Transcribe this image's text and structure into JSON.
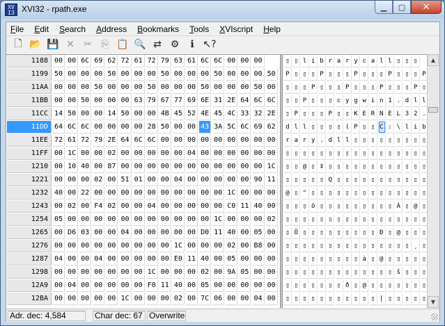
{
  "window": {
    "title": "XVI32 - rpath.exe"
  },
  "menu": [
    {
      "label": "File",
      "u": "F",
      "rest": "ile"
    },
    {
      "label": "Edit",
      "u": "E",
      "rest": "dit"
    },
    {
      "label": "Search",
      "u": "S",
      "rest": "earch"
    },
    {
      "label": "Address",
      "u": "A",
      "rest": "ddress"
    },
    {
      "label": "Bookmarks",
      "u": "B",
      "rest": "ookmarks"
    },
    {
      "label": "Tools",
      "u": "T",
      "rest": "ools"
    },
    {
      "label": "XVIscript",
      "u": "X",
      "rest": "VIscript"
    },
    {
      "label": "Help",
      "u": "H",
      "rest": "elp"
    }
  ],
  "toolbar": [
    {
      "name": "new-file-icon",
      "glyph": "🗋",
      "enabled": true
    },
    {
      "name": "open-folder-icon",
      "glyph": "📂",
      "enabled": true
    },
    {
      "name": "save-icon",
      "glyph": "💾",
      "enabled": true
    },
    {
      "name": "close-file-icon",
      "glyph": "✕",
      "enabled": false
    },
    {
      "name": "cut-icon",
      "glyph": "✂",
      "enabled": false
    },
    {
      "name": "copy-icon",
      "glyph": "⎘",
      "enabled": false
    },
    {
      "name": "paste-icon",
      "glyph": "📋",
      "enabled": true
    },
    {
      "name": "find-icon",
      "glyph": "🔍",
      "enabled": true
    },
    {
      "name": "replace-icon",
      "glyph": "⇄",
      "enabled": true
    },
    {
      "name": "properties-icon",
      "glyph": "⚙",
      "enabled": true
    },
    {
      "name": "script-icon",
      "glyph": "ℹ",
      "enabled": true
    },
    {
      "name": "context-help-icon",
      "glyph": "↖?",
      "enabled": true
    }
  ],
  "rows": [
    {
      "addr": "1188",
      "hex": [
        "00",
        "00",
        "6C",
        "69",
        "62",
        "72",
        "61",
        "72",
        "79",
        "63",
        "61",
        "6C",
        "6C",
        "00",
        "00",
        "00"
      ],
      "ascii": [
        "▯",
        "▯",
        "l",
        "i",
        "b",
        "r",
        "a",
        "r",
        "y",
        "c",
        "a",
        "l",
        "l",
        "▯",
        "▯",
        "▯"
      ]
    },
    {
      "addr": "1199",
      "hex": [
        "50",
        "00",
        "00",
        "00",
        "50",
        "00",
        "00",
        "00",
        "50",
        "00",
        "00",
        "00",
        "50",
        "00",
        "00",
        "00",
        "50"
      ],
      "ascii": [
        "P",
        "▯",
        "▯",
        "▯",
        "P",
        "▯",
        "▯",
        "▯",
        "P",
        "▯",
        "▯",
        "▯",
        "P",
        "▯",
        "▯",
        "▯",
        "P"
      ]
    },
    {
      "addr": "11AA",
      "hex": [
        "00",
        "00",
        "00",
        "50",
        "00",
        "00",
        "00",
        "50",
        "00",
        "00",
        "00",
        "50",
        "00",
        "00",
        "00",
        "50",
        "00"
      ],
      "ascii": [
        "▯",
        "▯",
        "▯",
        "P",
        "▯",
        "▯",
        "▯",
        "P",
        "▯",
        "▯",
        "▯",
        "P",
        "▯",
        "▯",
        "▯",
        "P",
        "▯"
      ]
    },
    {
      "addr": "11BB",
      "hex": [
        "00",
        "00",
        "50",
        "00",
        "00",
        "00",
        "63",
        "79",
        "67",
        "77",
        "69",
        "6E",
        "31",
        "2E",
        "64",
        "6C",
        "6C"
      ],
      "ascii": [
        "▯",
        "▯",
        "P",
        "▯",
        "▯",
        "▯",
        "c",
        "y",
        "g",
        "w",
        "i",
        "n",
        "1",
        ".",
        "d",
        "l",
        "l"
      ]
    },
    {
      "addr": "11CC",
      "hex": [
        "14",
        "50",
        "00",
        "00",
        "14",
        "50",
        "00",
        "00",
        "4B",
        "45",
        "52",
        "4E",
        "45",
        "4C",
        "33",
        "32",
        "2E"
      ],
      "ascii": [
        "▯",
        "P",
        "▯",
        "▯",
        "▯",
        "P",
        "▯",
        "▯",
        "K",
        "E",
        "R",
        "N",
        "E",
        "L",
        "3",
        "2",
        "."
      ]
    },
    {
      "addr": "11DD",
      "hex": [
        "64",
        "6C",
        "6C",
        "00",
        "00",
        "00",
        "00",
        "28",
        "50",
        "00",
        "00",
        "43",
        "3A",
        "5C",
        "6C",
        "69",
        "62"
      ],
      "ascii": [
        "d",
        "l",
        "l",
        "▯",
        "▯",
        "▯",
        "▯",
        "(",
        "P",
        "▯",
        "▯",
        "C",
        ":",
        "\\",
        "l",
        "i",
        "b"
      ]
    },
    {
      "addr": "11EE",
      "hex": [
        "72",
        "61",
        "72",
        "79",
        "2E",
        "64",
        "6C",
        "6C",
        "00",
        "00",
        "00",
        "00",
        "00",
        "00",
        "00",
        "00",
        "00"
      ],
      "ascii": [
        "r",
        "a",
        "r",
        "y",
        ".",
        "d",
        "l",
        "l",
        "▯",
        "▯",
        "▯",
        "▯",
        "▯",
        "▯",
        "▯",
        "▯",
        "▯"
      ]
    },
    {
      "addr": "11FF",
      "hex": [
        "00",
        "1C",
        "00",
        "00",
        "02",
        "00",
        "00",
        "00",
        "00",
        "00",
        "04",
        "00",
        "00",
        "00",
        "00",
        "00",
        "00"
      ],
      "ascii": [
        "▯",
        "▯",
        "▯",
        "▯",
        "▯",
        "▯",
        "▯",
        "▯",
        "▯",
        "▯",
        "▯",
        "▯",
        "▯",
        "▯",
        "▯",
        "▯",
        "▯"
      ]
    },
    {
      "addr": "1210",
      "hex": [
        "00",
        "10",
        "40",
        "00",
        "87",
        "00",
        "00",
        "00",
        "00",
        "00",
        "00",
        "00",
        "00",
        "00",
        "00",
        "00",
        "1C"
      ],
      "ascii": [
        "▯",
        "▯",
        "@",
        "▯",
        "‡",
        "▯",
        "▯",
        "▯",
        "▯",
        "▯",
        "▯",
        "▯",
        "▯",
        "▯",
        "▯",
        "▯",
        "▯"
      ]
    },
    {
      "addr": "1221",
      "hex": [
        "00",
        "00",
        "00",
        "02",
        "00",
        "51",
        "01",
        "00",
        "00",
        "04",
        "00",
        "00",
        "00",
        "00",
        "00",
        "90",
        "11"
      ],
      "ascii": [
        "▯",
        "▯",
        "▯",
        "▯",
        "▯",
        "Q",
        "▯",
        "▯",
        "▯",
        "▯",
        "▯",
        "▯",
        "▯",
        "▯",
        "▯",
        "▯",
        "▯"
      ]
    },
    {
      "addr": "1232",
      "hex": [
        "40",
        "00",
        "22",
        "00",
        "00",
        "00",
        "00",
        "00",
        "00",
        "00",
        "00",
        "00",
        "00",
        "1C",
        "00",
        "00",
        "00"
      ],
      "ascii": [
        "@",
        "▯",
        "\"",
        "▯",
        "▯",
        "▯",
        "▯",
        "▯",
        "▯",
        "▯",
        "▯",
        "▯",
        "▯",
        "▯",
        "▯",
        "▯",
        "▯"
      ]
    },
    {
      "addr": "1243",
      "hex": [
        "00",
        "02",
        "00",
        "F4",
        "02",
        "00",
        "00",
        "04",
        "00",
        "00",
        "00",
        "00",
        "00",
        "C0",
        "11",
        "40",
        "00"
      ],
      "ascii": [
        "▯",
        "▯",
        "▯",
        "ô",
        "▯",
        "▯",
        "▯",
        "▯",
        "▯",
        "▯",
        "▯",
        "▯",
        "▯",
        "À",
        "▯",
        "@",
        "▯"
      ]
    },
    {
      "addr": "1254",
      "hex": [
        "05",
        "00",
        "00",
        "00",
        "00",
        "00",
        "00",
        "00",
        "00",
        "00",
        "00",
        "00",
        "1C",
        "00",
        "00",
        "00",
        "02"
      ],
      "ascii": [
        "▯",
        "▯",
        "▯",
        "▯",
        "▯",
        "▯",
        "▯",
        "▯",
        "▯",
        "▯",
        "▯",
        "▯",
        "▯",
        "▯",
        "▯",
        "▯",
        "▯"
      ]
    },
    {
      "addr": "1265",
      "hex": [
        "00",
        "D6",
        "03",
        "00",
        "00",
        "04",
        "00",
        "00",
        "00",
        "00",
        "00",
        "D0",
        "11",
        "40",
        "00",
        "05",
        "00"
      ],
      "ascii": [
        "▯",
        "Ö",
        "▯",
        "▯",
        "▯",
        "▯",
        "▯",
        "▯",
        "▯",
        "▯",
        "▯",
        "Ð",
        "▯",
        "@",
        "▯",
        "▯",
        "▯"
      ]
    },
    {
      "addr": "1276",
      "hex": [
        "00",
        "00",
        "00",
        "00",
        "00",
        "00",
        "00",
        "00",
        "00",
        "1C",
        "00",
        "00",
        "00",
        "02",
        "00",
        "B8",
        "00"
      ],
      "ascii": [
        "▯",
        "▯",
        "▯",
        "▯",
        "▯",
        "▯",
        "▯",
        "▯",
        "▯",
        "▯",
        "▯",
        "▯",
        "▯",
        "▯",
        "▯",
        "¸",
        "▯"
      ]
    },
    {
      "addr": "1287",
      "hex": [
        "04",
        "00",
        "00",
        "04",
        "00",
        "00",
        "00",
        "00",
        "00",
        "E0",
        "11",
        "40",
        "00",
        "05",
        "00",
        "00",
        "00"
      ],
      "ascii": [
        "▯",
        "▯",
        "▯",
        "▯",
        "▯",
        "▯",
        "▯",
        "▯",
        "▯",
        "à",
        "▯",
        "@",
        "▯",
        "▯",
        "▯",
        "▯",
        "▯"
      ]
    },
    {
      "addr": "1298",
      "hex": [
        "00",
        "00",
        "00",
        "00",
        "00",
        "00",
        "00",
        "1C",
        "00",
        "00",
        "00",
        "02",
        "00",
        "9A",
        "05",
        "00",
        "00"
      ],
      "ascii": [
        "▯",
        "▯",
        "▯",
        "▯",
        "▯",
        "▯",
        "▯",
        "▯",
        "▯",
        "▯",
        "▯",
        "▯",
        "▯",
        "š",
        "▯",
        "▯",
        "▯"
      ]
    },
    {
      "addr": "12A9",
      "hex": [
        "00",
        "04",
        "00",
        "00",
        "00",
        "00",
        "00",
        "F0",
        "11",
        "40",
        "00",
        "05",
        "00",
        "00",
        "00",
        "00",
        "00"
      ],
      "ascii": [
        "▯",
        "▯",
        "▯",
        "▯",
        "▯",
        "▯",
        "▯",
        "ð",
        "▯",
        "@",
        "▯",
        "▯",
        "▯",
        "▯",
        "▯",
        "▯",
        "▯"
      ]
    },
    {
      "addr": "12BA",
      "hex": [
        "00",
        "00",
        "00",
        "00",
        "00",
        "1C",
        "00",
        "00",
        "00",
        "02",
        "00",
        "7C",
        "06",
        "00",
        "00",
        "04",
        "00"
      ],
      "ascii": [
        "▯",
        "▯",
        "▯",
        "▯",
        "▯",
        "▯",
        "▯",
        "▯",
        "▯",
        "▯",
        "▯",
        "|",
        "▯",
        "▯",
        "▯",
        "▯",
        "▯"
      ]
    }
  ],
  "selection": {
    "row": 5,
    "col": 11
  },
  "status": {
    "address": "Adr. dec: 4,584",
    "char": "Char dec: 67",
    "mode": "Overwrite"
  }
}
